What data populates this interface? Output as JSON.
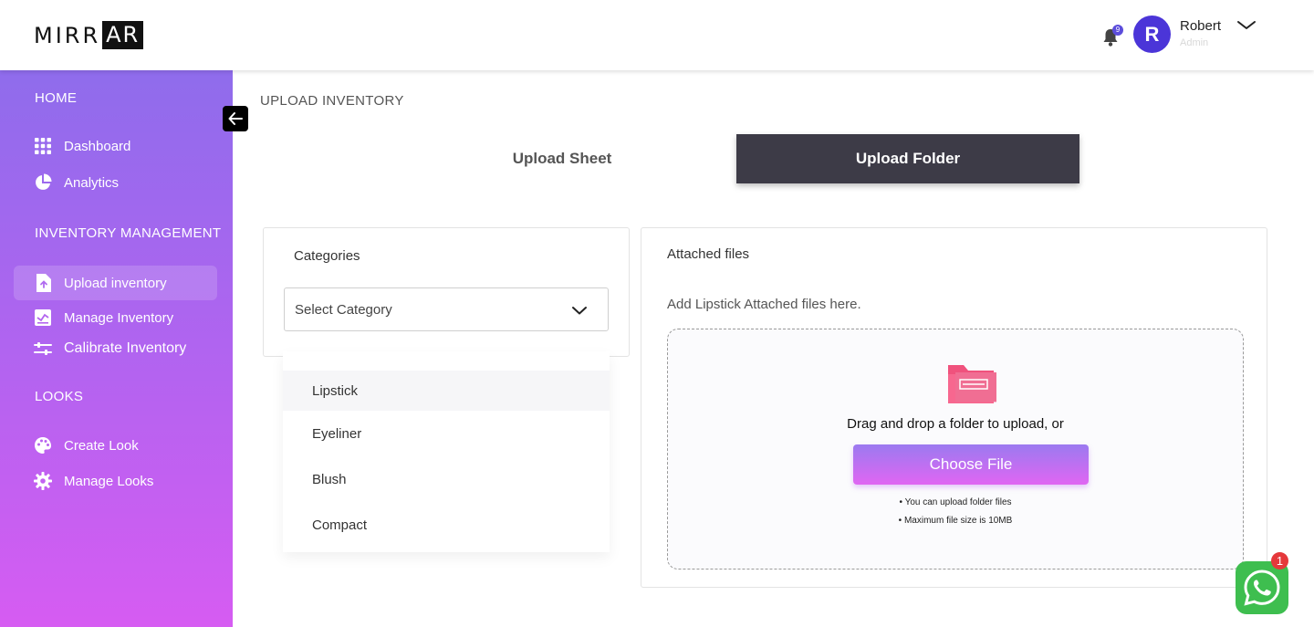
{
  "header": {
    "logo_prefix": "MIRR",
    "logo_box": "AR",
    "notification_count": "9",
    "avatar_initial": "R",
    "user_name": "Robert",
    "user_role": "Admin"
  },
  "sidebar": {
    "sections": {
      "home": "HOME",
      "inventory": "INVENTORY MANAGEMENT",
      "looks": "LOOKS"
    },
    "items": [
      {
        "label": "Dashboard",
        "icon": "grid-icon"
      },
      {
        "label": "Analytics",
        "icon": "pie-chart-icon"
      },
      {
        "label": "Upload inventory",
        "icon": "upload-file-icon",
        "active": true
      },
      {
        "label": "Manage Inventory",
        "icon": "chart-box-icon"
      },
      {
        "label": "Calibrate Inventory",
        "icon": "sliders-icon"
      },
      {
        "label": "Create Look",
        "icon": "palette-icon"
      },
      {
        "label": "Manage Looks",
        "icon": "gear-icon"
      }
    ]
  },
  "main": {
    "page_title": "UPLOAD INVENTORY",
    "tabs": [
      {
        "label": "Upload Sheet",
        "active": false
      },
      {
        "label": "Upload Folder",
        "active": true
      }
    ],
    "categories": {
      "label": "Categories",
      "select_placeholder": "Select Category",
      "options": [
        "Lipstick",
        "Eyeliner",
        "Blush",
        "Compact"
      ]
    },
    "attached": {
      "title": "Attached files",
      "subtitle": "Add Lipstick Attached files here.",
      "drag_text": "Drag and drop a folder to upload, or",
      "button": "Choose File",
      "notes": [
        "• You can upload folder files",
        "• Maximum file size is 10MB"
      ]
    }
  },
  "whatsapp": {
    "badge": "1"
  },
  "colors": {
    "sidebar_top": "#8f6cec",
    "sidebar_bottom": "#d65cf2",
    "active_tab": "#3d3b47",
    "avatar": "#4b35d8",
    "folder_icon": "#f0527d",
    "whatsapp": "#3ebe4f"
  }
}
